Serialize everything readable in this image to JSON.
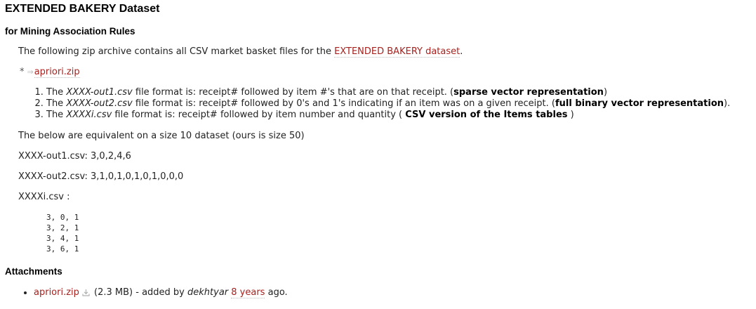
{
  "title": "EXTENDED BAKERY Dataset",
  "subtitle": "for Mining Association Rules",
  "intro": {
    "prefix": "The following zip archive contains all CSV market basket files for the ",
    "link": "EXTENDED BAKERY dataset",
    "suffix": "."
  },
  "zip_link": {
    "bullet": "*",
    "icon": "external-arrow-icon",
    "label": "apriori.zip"
  },
  "formats": [
    {
      "pre": "The ",
      "file": "XXXX-out1.csv",
      "mid": " file format is: receipt# followed by item #'s that are on that receipt. (",
      "bold": "sparse vector representation",
      "post": ")"
    },
    {
      "pre": "The ",
      "file": "XXXX-out2.csv",
      "mid": " file format is: receipt# followed by 0's and 1's indicating if an item was on a given receipt. (",
      "bold": "full binary vector representation",
      "post": ")."
    },
    {
      "pre": "The ",
      "file": "XXXXi.csv",
      "mid": " file format is: receipt# followed by item number and quantity ( ",
      "bold": "CSV version of the Items tables",
      "post": " )"
    }
  ],
  "equivalent_note": "The below are equivalent on a size 10 dataset (ours is size 50)",
  "example_out1": "XXXX-out1.csv: 3,0,2,4,6",
  "example_out2": "XXXX-out2.csv: 3,1,0,1,0,1,0,1,0,0,0",
  "example_items_label": "XXXXi.csv :",
  "example_items_rows": "3, 0, 1\n3, 2, 1\n3, 4, 1\n3, 6, 1",
  "attachments": {
    "title": "Attachments",
    "file_name": "apriori.zip",
    "download_icon": "download-icon",
    "size_text": " (2.3 MB) - added by ",
    "author": "dekhtyar",
    "spacer": " ",
    "age": "8 years",
    "tail": " ago."
  },
  "colors": {
    "link": "#a7221f",
    "text": "#222222",
    "heading": "#000000"
  }
}
